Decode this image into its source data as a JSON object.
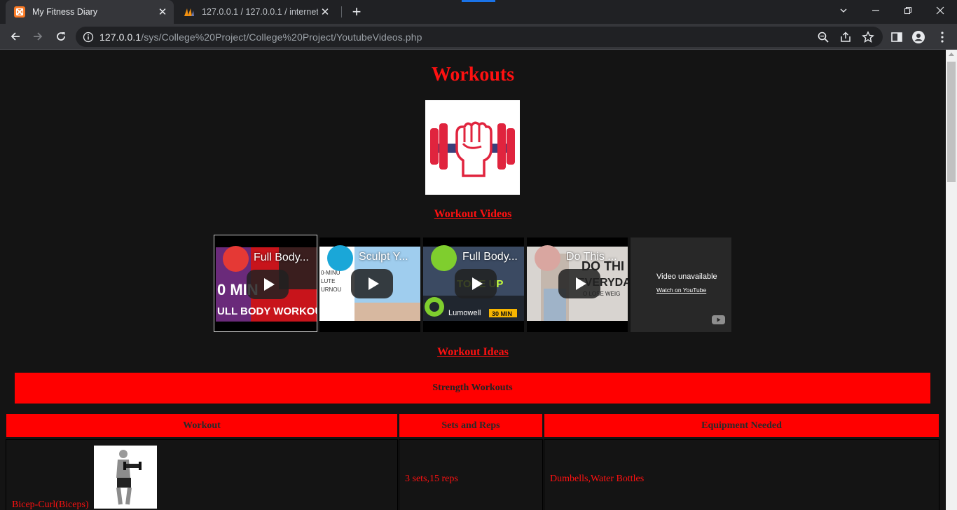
{
  "browser": {
    "tabs": [
      {
        "title": "My Fitness Diary",
        "icon": "xampp-icon",
        "active": true
      },
      {
        "title": "127.0.0.1 / 127.0.0.1 / internetpro",
        "icon": "phpmyadmin-icon",
        "active": false
      }
    ],
    "url_host": "127.0.0.1",
    "url_path": "/sys/College%20Project/College%20Project/YoutubeVideos.php"
  },
  "page": {
    "title": "Workouts",
    "logo_icon": "fist-dumbbell-logo",
    "videos_heading": "Workout Videos",
    "videos": [
      {
        "title": "Full Body...",
        "thumb_color": "#c8141b",
        "channel_color": "#e53935"
      },
      {
        "title": "Sculpt Y...",
        "thumb_color": "#8fc3e8",
        "channel_color": "#1aa7d8"
      },
      {
        "title": "Full Body...",
        "thumb_color": "#3b4a62",
        "channel_color": "#7fce2e"
      },
      {
        "title": "Do This ...",
        "thumb_color": "#c8c3bf",
        "channel_color": "#d9a6a0"
      }
    ],
    "unavailable_message": "Video unavailable",
    "unavailable_link": "Watch on YouTube",
    "ideas_heading": "Workout Ideas",
    "strength_banner": "Strength Workouts",
    "table": {
      "headers": [
        "Workout",
        "Sets and Reps",
        "Equipment Needed"
      ],
      "rows": [
        {
          "workout": "Bicep-Curl(Biceps)",
          "sets": "3 sets,15 reps",
          "equipment": "Dumbells,Water Bottles"
        }
      ]
    }
  },
  "colors": {
    "accent": "#ff0000",
    "heading": "#ff1111",
    "page_bg": "#141414"
  }
}
